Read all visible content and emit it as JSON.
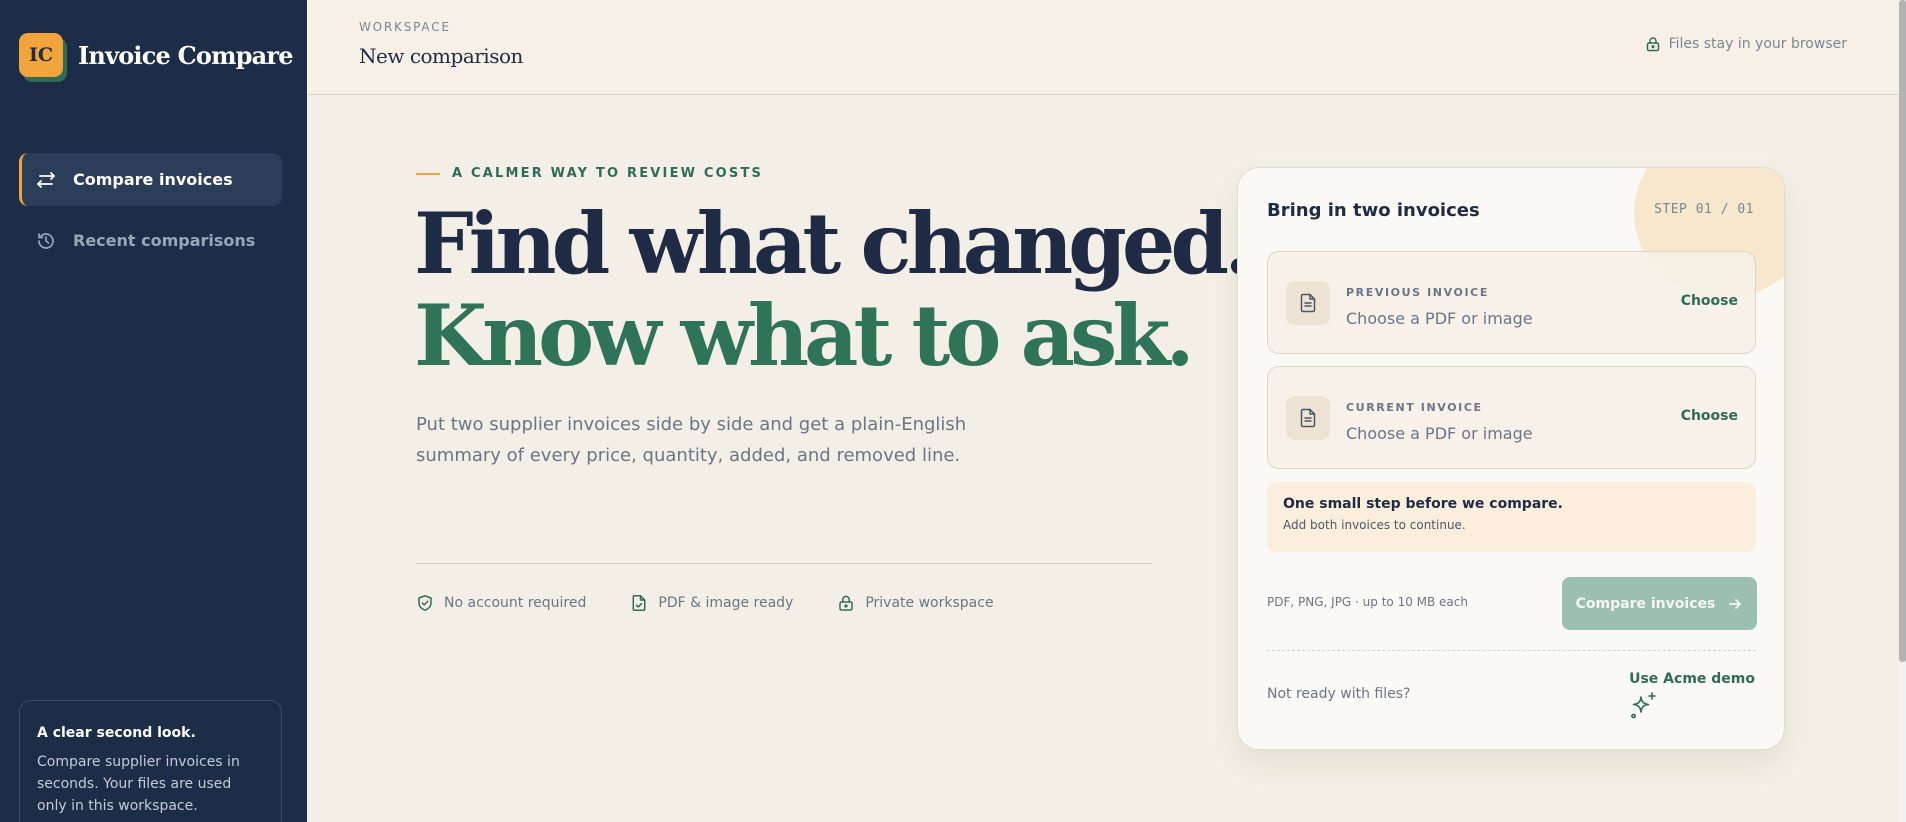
{
  "app": {
    "logo_text": "IC",
    "name": "Invoice Compare"
  },
  "sidebar": {
    "items": [
      {
        "label": "Compare invoices",
        "icon": "swap-arrows-icon",
        "active": true
      },
      {
        "label": "Recent comparisons",
        "icon": "history-icon",
        "active": false
      }
    ],
    "card": {
      "title": "A clear second look.",
      "body": "Compare supplier invoices in seconds. Your files are used only in this workspace."
    }
  },
  "header": {
    "label": "WORKSPACE",
    "title": "New comparison",
    "privacy_note": "Files stay in your browser"
  },
  "hero": {
    "eyebrow": "A CALMER WAY TO REVIEW COSTS",
    "headline_1": "Find what changed.",
    "headline_2": "Know what to ask.",
    "lede": "Put two supplier invoices side by side and get a plain-English summary of every price, quantity, added, and removed line.",
    "features": [
      {
        "label": "No account required",
        "icon": "shield-check-icon"
      },
      {
        "label": "PDF & image ready",
        "icon": "file-check-icon"
      },
      {
        "label": "Private workspace",
        "icon": "lock-icon"
      }
    ]
  },
  "card": {
    "title": "Bring in two invoices",
    "step": "STEP 01 / 01",
    "previous": {
      "label": "PREVIOUS INVOICE",
      "hint": "Choose a PDF or image",
      "action": "Choose"
    },
    "current": {
      "label": "CURRENT INVOICE",
      "hint": "Choose a PDF or image",
      "action": "Choose"
    },
    "notice": {
      "title": "One small step before we compare.",
      "detail": "Add both invoices to continue."
    },
    "formats": "PDF, PNG, JPG · up to 10 MB each",
    "compare_label": "Compare invoices",
    "not_ready": "Not ready with files?",
    "demo_label": "Use Acme demo"
  },
  "colors": {
    "sidebar": "#1e2d47",
    "accent": "#f0a43a",
    "brand_green": "#2f6b55",
    "background": "#f3efe6"
  }
}
